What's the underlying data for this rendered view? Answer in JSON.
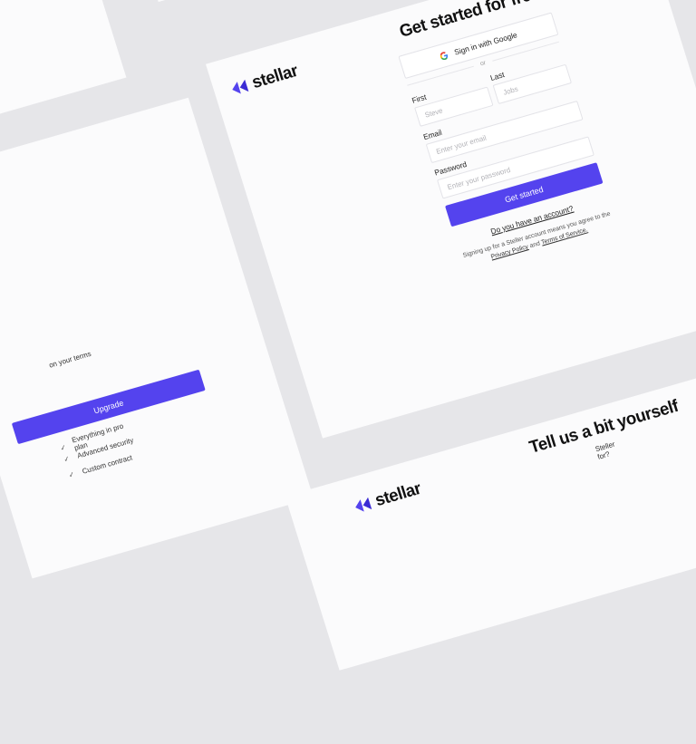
{
  "brand": {
    "name": "stellar",
    "accent": "#5443ee"
  },
  "signup": {
    "title": "Get started for free",
    "google_label": "Sign in with Google",
    "divider": "or",
    "first_name": {
      "label": "First name",
      "placeholder": "Steve"
    },
    "last_name": {
      "label": "Last name",
      "placeholder": "Jobs"
    },
    "email": {
      "label": "Email",
      "placeholder": "Enter your email"
    },
    "password": {
      "label": "Password",
      "placeholder": "Enter your password"
    },
    "submit_label": "Get started",
    "account_link": "Do you have an account?",
    "terms_prefix": "Signing up for a Steller account means you agree to the",
    "privacy_link": "Privacy Policy",
    "terms_and": "and",
    "terms_link": "Terms of Service."
  },
  "pricing": {
    "partial_text": "on your terms",
    "upgrade_label": "Upgrade",
    "features": [
      "Everything in pro plan",
      "Advanced security",
      "Custom contract"
    ]
  },
  "onboarding": {
    "title": "Tell us a bit yourself",
    "question_partial": "Steller for?"
  }
}
